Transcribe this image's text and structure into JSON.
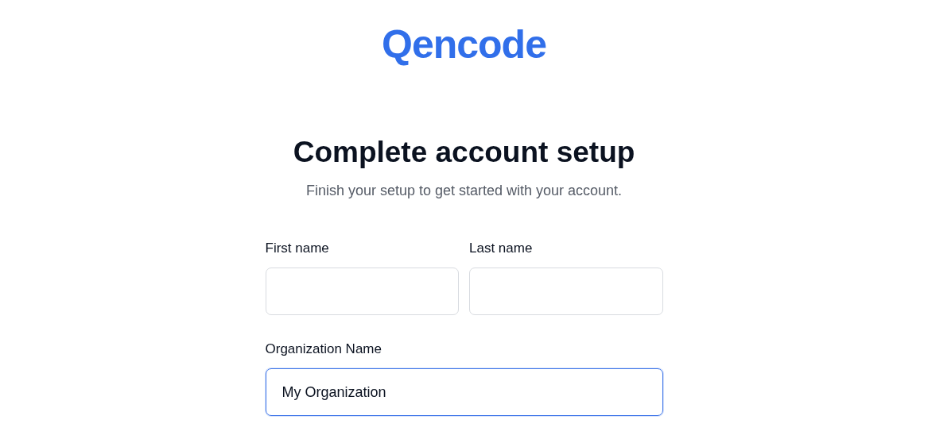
{
  "logo": "Qencode",
  "heading": "Complete account setup",
  "subtitle": "Finish your setup to get started with your account.",
  "name_fields": [
    {
      "label": "First name",
      "focused": false
    },
    {
      "label": "Last name",
      "focused": false
    }
  ],
  "organization_field": {
    "label": "Organization Name",
    "value": "My Organization",
    "focused": true
  }
}
